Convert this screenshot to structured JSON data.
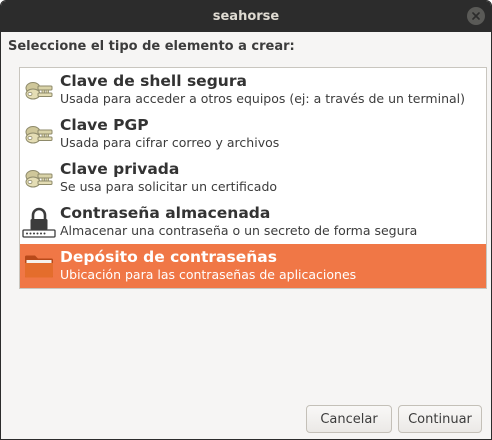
{
  "window": {
    "title": "seahorse"
  },
  "prompt": "Seleccione el tipo de elemento a crear:",
  "items": [
    {
      "name": "Clave de shell segura",
      "description": "Usada para acceder a otros equipos (ej: a través de un terminal)",
      "icon": "key-icon",
      "selected": false
    },
    {
      "name": "Clave PGP",
      "description": "Usada para cifrar correo y archivos",
      "icon": "key-icon",
      "selected": false
    },
    {
      "name": "Clave privada",
      "description": "Se usa para solicitar un certificado",
      "icon": "key-icon",
      "selected": false
    },
    {
      "name": "Contraseña almacenada",
      "description": "Almacenar una contraseña o un secreto de forma segura",
      "icon": "password-lock-icon",
      "selected": false
    },
    {
      "name": "Depósito de contraseñas",
      "description": "Ubicación para las contraseñas de aplicaciones",
      "icon": "folder-icon",
      "selected": true
    }
  ],
  "buttons": {
    "cancel": "Cancelar",
    "continue": "Continuar"
  },
  "colors": {
    "titlebar": "#2c2c2c",
    "selection": "#f07746",
    "window_bg": "#f6f5f4"
  }
}
